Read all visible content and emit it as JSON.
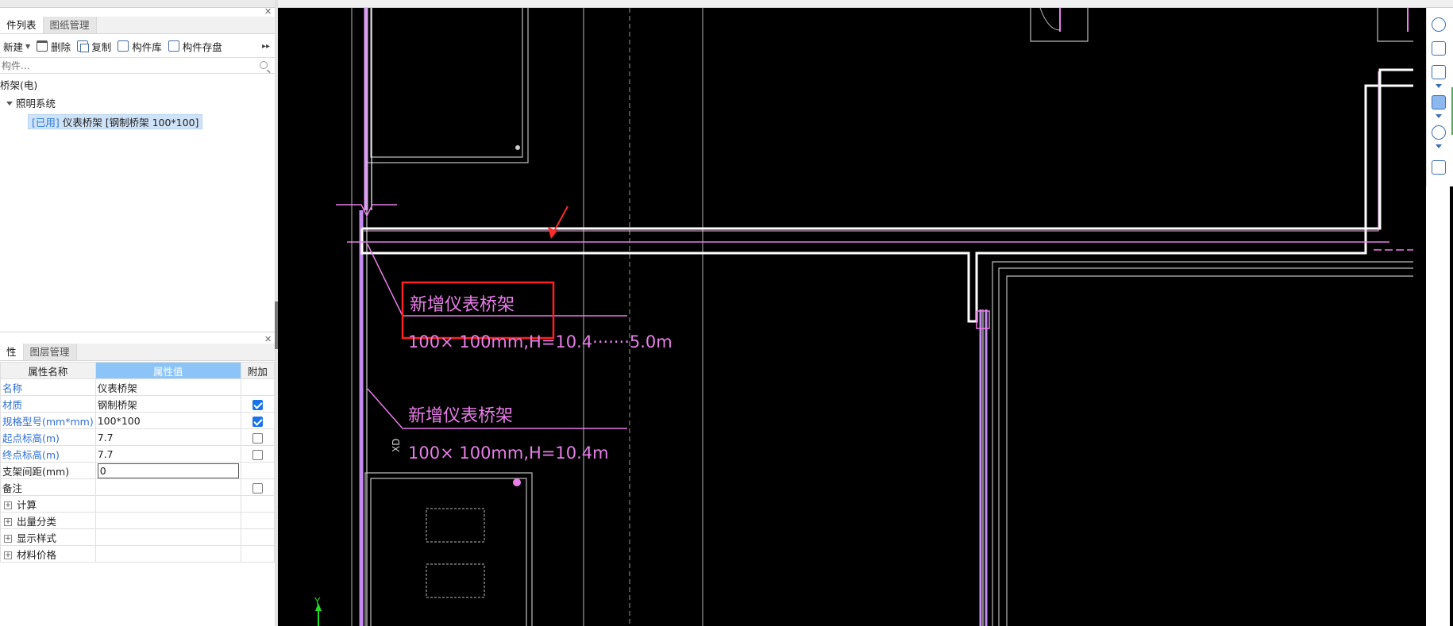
{
  "component_panel": {
    "tabs": [
      {
        "label": "件列表",
        "active": true
      },
      {
        "label": "图纸管理",
        "active": false
      }
    ],
    "toolbar": {
      "new": "新建",
      "delete": "删除",
      "copy": "复制",
      "library": "构件库",
      "save_disk": "构件存盘"
    },
    "search_placeholder": "构件...",
    "tree": {
      "root": "桥架(电)",
      "group": "照明系统",
      "selected_tag": "[已用]",
      "selected_item": "仪表桥架 [钢制桥架 100*100]"
    }
  },
  "property_panel": {
    "tabs": [
      {
        "label": "性",
        "active": true
      },
      {
        "label": "图层管理",
        "active": false
      }
    ],
    "headers": {
      "name": "属性名称",
      "value": "属性值",
      "extra": "附加"
    },
    "rows": [
      {
        "name": "名称",
        "value": "仪表桥架",
        "check": null
      },
      {
        "name": "材质",
        "value": "钢制桥架",
        "check": true
      },
      {
        "name": "规格型号(mm*mm)",
        "value": "100*100",
        "check": true
      },
      {
        "name": "起点标高(m)",
        "value": "7.7",
        "check": false
      },
      {
        "name": "终点标高(m)",
        "value": "7.7",
        "check": false
      },
      {
        "name": "支架间距(mm)",
        "value": "0",
        "check": null,
        "editing": true
      },
      {
        "name": "备注",
        "value": "",
        "check": false
      }
    ],
    "groups": [
      "计算",
      "出量分类",
      "显示样式",
      "材料价格"
    ]
  },
  "drawing": {
    "annotations": [
      {
        "title": "新增仪表桥架",
        "spec": "100× 100mm,H=10.4·······5.0m"
      },
      {
        "title": "新增仪表桥架",
        "spec": "100× 100mm,H=10.4m"
      }
    ],
    "rotated_label": "XD",
    "axis_label": "Y",
    "colors": {
      "cad_magenta": "#e87ee8",
      "highlight_box": "#ff2020",
      "tray_white": "#ffffff"
    }
  }
}
